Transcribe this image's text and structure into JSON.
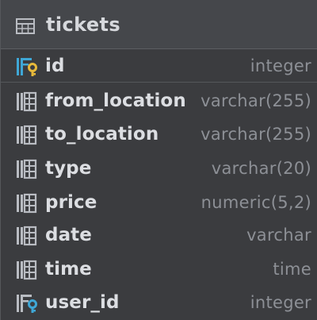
{
  "table": {
    "name": "tickets"
  },
  "columns": [
    {
      "name": "id",
      "type": "integer",
      "key": "primary"
    },
    {
      "name": "from_location",
      "type": "varchar(255)",
      "key": "none"
    },
    {
      "name": "to_location",
      "type": "varchar(255)",
      "key": "none"
    },
    {
      "name": "type",
      "type": "varchar(20)",
      "key": "none"
    },
    {
      "name": "price",
      "type": "numeric(5,2)",
      "key": "none"
    },
    {
      "name": "date",
      "type": "varchar",
      "key": "none"
    },
    {
      "name": "time",
      "type": "time",
      "key": "none"
    },
    {
      "name": "user_id",
      "type": "integer",
      "key": "foreign"
    }
  ],
  "colors": {
    "primary_key": "#e8b93a",
    "foreign_key": "#3fa7d6",
    "column_icon": "#b9bcc2"
  }
}
